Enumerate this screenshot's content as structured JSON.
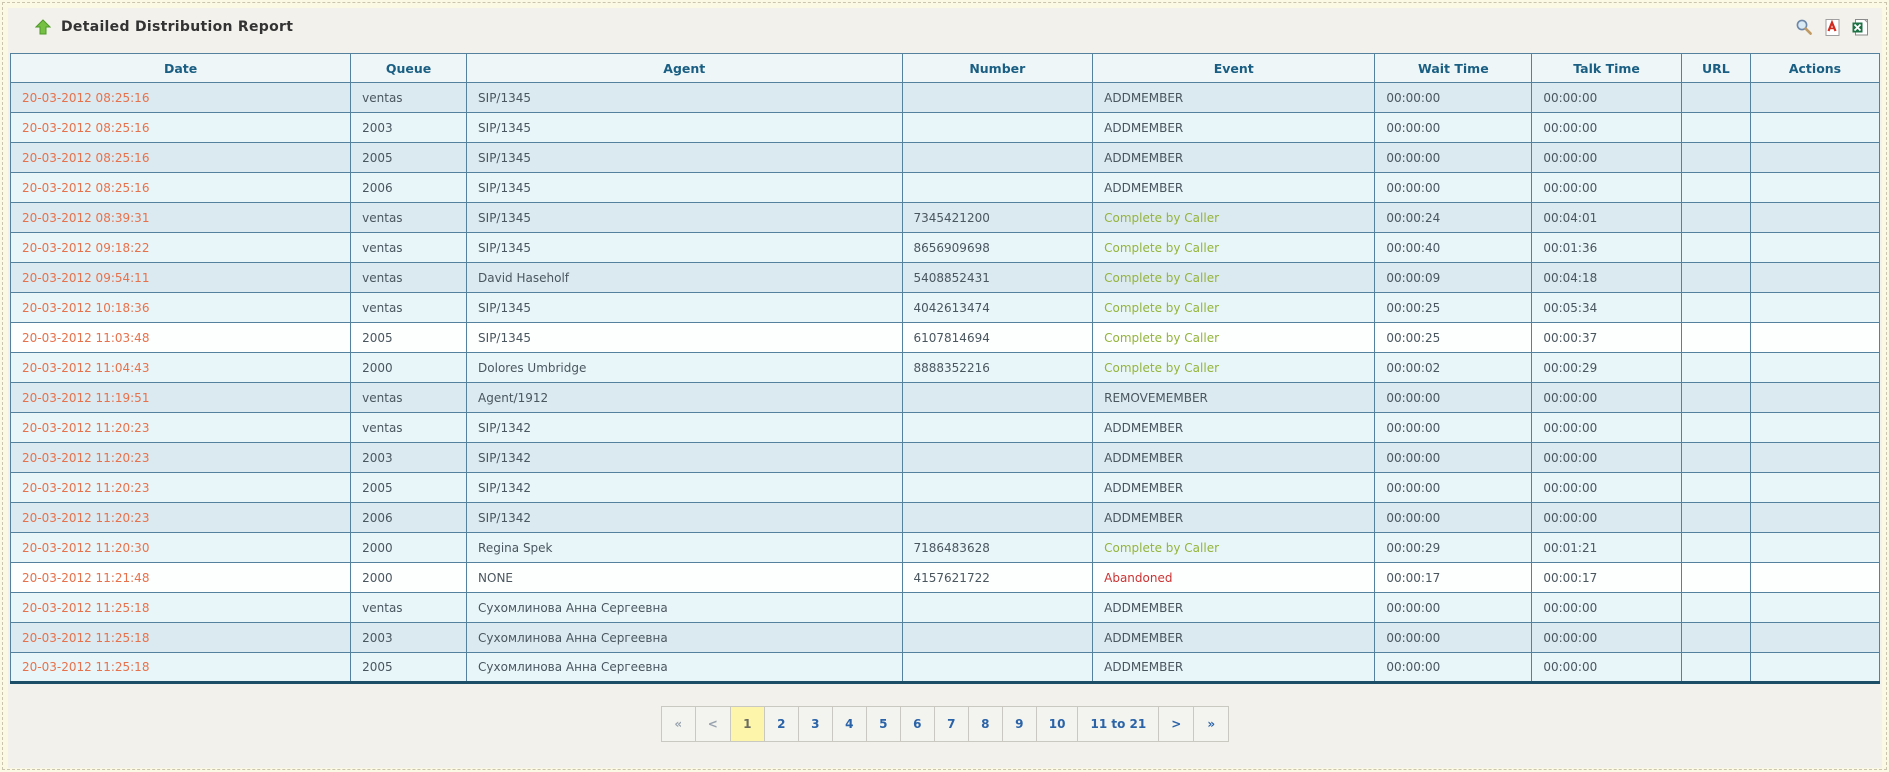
{
  "header": {
    "title": "Detailed Distribution Report",
    "icons": {
      "search": "search-icon",
      "pdf_export": "pdf-export-icon",
      "excel_export": "excel-export-icon"
    }
  },
  "colors": {
    "page_background": "#fbf8e3",
    "panel_background": "#f2f1ec",
    "grid_border": "#54819e",
    "header_text": "#1a5f83",
    "date_text": "#e7714b",
    "event_complete": "#94b43c",
    "event_abandoned": "#cc3333",
    "row_dark": "#dbe9f0",
    "row_light": "#e9f6f9",
    "row_white": "#fdfefe",
    "current_page_background": "#fdf6aa",
    "link_text": "#2a63a7"
  },
  "table": {
    "columns": [
      {
        "label": "Date"
      },
      {
        "label": "Queue"
      },
      {
        "label": "Agent"
      },
      {
        "label": "Number"
      },
      {
        "label": "Event"
      },
      {
        "label": "Wait Time"
      },
      {
        "label": "Talk Time"
      },
      {
        "label": "URL"
      },
      {
        "label": "Actions"
      }
    ],
    "rows": [
      {
        "date": "20-03-2012 08:25:16",
        "queue": "ventas",
        "agent": "SIP/1345",
        "number": "",
        "event": "ADDMEMBER",
        "event_type": "neutral",
        "wait": "00:00:00",
        "talk": "00:00:00",
        "url": "",
        "actions": "",
        "shade": "dark"
      },
      {
        "date": "20-03-2012 08:25:16",
        "queue": "2003",
        "agent": "SIP/1345",
        "number": "",
        "event": "ADDMEMBER",
        "event_type": "neutral",
        "wait": "00:00:00",
        "talk": "00:00:00",
        "url": "",
        "actions": "",
        "shade": "light"
      },
      {
        "date": "20-03-2012 08:25:16",
        "queue": "2005",
        "agent": "SIP/1345",
        "number": "",
        "event": "ADDMEMBER",
        "event_type": "neutral",
        "wait": "00:00:00",
        "talk": "00:00:00",
        "url": "",
        "actions": "",
        "shade": "dark"
      },
      {
        "date": "20-03-2012 08:25:16",
        "queue": "2006",
        "agent": "SIP/1345",
        "number": "",
        "event": "ADDMEMBER",
        "event_type": "neutral",
        "wait": "00:00:00",
        "talk": "00:00:00",
        "url": "",
        "actions": "",
        "shade": "light"
      },
      {
        "date": "20-03-2012 08:39:31",
        "queue": "ventas",
        "agent": "SIP/1345",
        "number": "7345421200",
        "event": "Complete by Caller",
        "event_type": "complete",
        "wait": "00:00:24",
        "talk": "00:04:01",
        "url": "",
        "actions": "",
        "shade": "dark"
      },
      {
        "date": "20-03-2012 09:18:22",
        "queue": "ventas",
        "agent": "SIP/1345",
        "number": "8656909698",
        "event": "Complete by Caller",
        "event_type": "complete",
        "wait": "00:00:40",
        "talk": "00:01:36",
        "url": "",
        "actions": "",
        "shade": "light"
      },
      {
        "date": "20-03-2012 09:54:11",
        "queue": "ventas",
        "agent": "David Haseholf",
        "number": "5408852431",
        "event": "Complete by Caller",
        "event_type": "complete",
        "wait": "00:00:09",
        "talk": "00:04:18",
        "url": "",
        "actions": "",
        "shade": "dark"
      },
      {
        "date": "20-03-2012 10:18:36",
        "queue": "ventas",
        "agent": "SIP/1345",
        "number": "4042613474",
        "event": "Complete by Caller",
        "event_type": "complete",
        "wait": "00:00:25",
        "talk": "00:05:34",
        "url": "",
        "actions": "",
        "shade": "light"
      },
      {
        "date": "20-03-2012 11:03:48",
        "queue": "2005",
        "agent": "SIP/1345",
        "number": "6107814694",
        "event": "Complete by Caller",
        "event_type": "complete",
        "wait": "00:00:25",
        "talk": "00:00:37",
        "url": "",
        "actions": "",
        "shade": "white"
      },
      {
        "date": "20-03-2012 11:04:43",
        "queue": "2000",
        "agent": "Dolores Umbridge",
        "number": "8888352216",
        "event": "Complete by Caller",
        "event_type": "complete",
        "wait": "00:00:02",
        "talk": "00:00:29",
        "url": "",
        "actions": "",
        "shade": "light"
      },
      {
        "date": "20-03-2012 11:19:51",
        "queue": "ventas",
        "agent": "Agent/1912",
        "number": "",
        "event": "REMOVEMEMBER",
        "event_type": "neutral",
        "wait": "00:00:00",
        "talk": "00:00:00",
        "url": "",
        "actions": "",
        "shade": "dark"
      },
      {
        "date": "20-03-2012 11:20:23",
        "queue": "ventas",
        "agent": "SIP/1342",
        "number": "",
        "event": "ADDMEMBER",
        "event_type": "neutral",
        "wait": "00:00:00",
        "talk": "00:00:00",
        "url": "",
        "actions": "",
        "shade": "light"
      },
      {
        "date": "20-03-2012 11:20:23",
        "queue": "2003",
        "agent": "SIP/1342",
        "number": "",
        "event": "ADDMEMBER",
        "event_type": "neutral",
        "wait": "00:00:00",
        "talk": "00:00:00",
        "url": "",
        "actions": "",
        "shade": "dark"
      },
      {
        "date": "20-03-2012 11:20:23",
        "queue": "2005",
        "agent": "SIP/1342",
        "number": "",
        "event": "ADDMEMBER",
        "event_type": "neutral",
        "wait": "00:00:00",
        "talk": "00:00:00",
        "url": "",
        "actions": "",
        "shade": "light"
      },
      {
        "date": "20-03-2012 11:20:23",
        "queue": "2006",
        "agent": "SIP/1342",
        "number": "",
        "event": "ADDMEMBER",
        "event_type": "neutral",
        "wait": "00:00:00",
        "talk": "00:00:00",
        "url": "",
        "actions": "",
        "shade": "dark"
      },
      {
        "date": "20-03-2012 11:20:30",
        "queue": "2000",
        "agent": "Regina Spek",
        "number": "7186483628",
        "event": "Complete by Caller",
        "event_type": "complete",
        "wait": "00:00:29",
        "talk": "00:01:21",
        "url": "",
        "actions": "",
        "shade": "light"
      },
      {
        "date": "20-03-2012 11:21:48",
        "queue": "2000",
        "agent": "NONE",
        "number": "4157621722",
        "event": "Abandoned",
        "event_type": "abandoned",
        "wait": "00:00:17",
        "talk": "00:00:17",
        "url": "",
        "actions": "",
        "shade": "white"
      },
      {
        "date": "20-03-2012 11:25:18",
        "queue": "ventas",
        "agent": "Сухомлинова Анна Сергеевна",
        "number": "",
        "event": "ADDMEMBER",
        "event_type": "neutral",
        "wait": "00:00:00",
        "talk": "00:00:00",
        "url": "",
        "actions": "",
        "shade": "light"
      },
      {
        "date": "20-03-2012 11:25:18",
        "queue": "2003",
        "agent": "Сухомлинова Анна Сергеевна",
        "number": "",
        "event": "ADDMEMBER",
        "event_type": "neutral",
        "wait": "00:00:00",
        "talk": "00:00:00",
        "url": "",
        "actions": "",
        "shade": "dark"
      },
      {
        "date": "20-03-2012 11:25:18",
        "queue": "2005",
        "agent": "Сухомлинова Анна Сергеевна",
        "number": "",
        "event": "ADDMEMBER",
        "event_type": "neutral",
        "wait": "00:00:00",
        "talk": "00:00:00",
        "url": "",
        "actions": "",
        "shade": "light"
      }
    ]
  },
  "pagination": {
    "items": [
      {
        "label": "«",
        "type": "nav"
      },
      {
        "label": "<",
        "type": "nav"
      },
      {
        "label": "1",
        "type": "current"
      },
      {
        "label": "2",
        "type": "link"
      },
      {
        "label": "3",
        "type": "link"
      },
      {
        "label": "4",
        "type": "link"
      },
      {
        "label": "5",
        "type": "link"
      },
      {
        "label": "6",
        "type": "link"
      },
      {
        "label": "7",
        "type": "link"
      },
      {
        "label": "8",
        "type": "link"
      },
      {
        "label": "9",
        "type": "link"
      },
      {
        "label": "10",
        "type": "link"
      },
      {
        "label": "11 to 21",
        "type": "link"
      },
      {
        "label": ">",
        "type": "link"
      },
      {
        "label": "»",
        "type": "link"
      }
    ]
  }
}
